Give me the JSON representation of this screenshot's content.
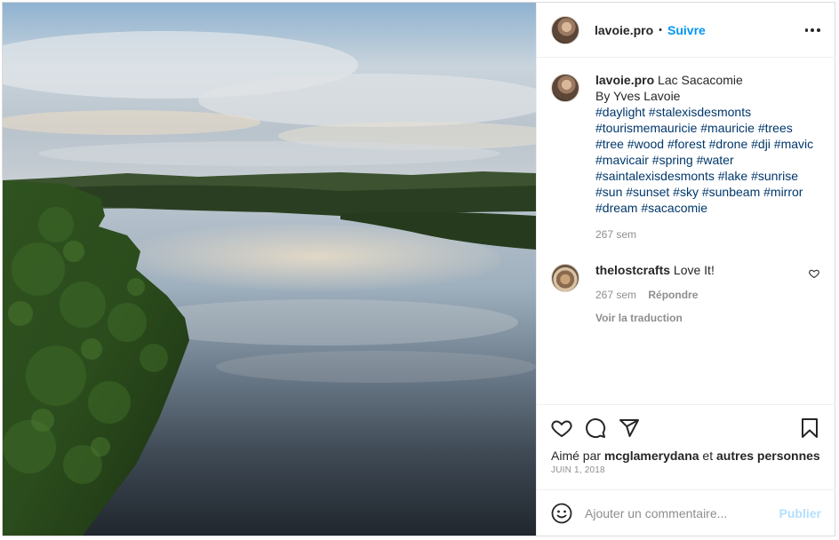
{
  "header": {
    "username": "lavoie.pro",
    "separator": "•",
    "follow_label": "Suivre"
  },
  "caption": {
    "username": "lavoie.pro",
    "title": "Lac Sacacomie",
    "byline": "By Yves Lavoie",
    "hashtags": "#daylight #stalexisdesmonts #tourismemauricie #mauricie #trees #tree #wood #forest #drone #dji #mavic #mavicair #spring #water #saintalexisdesmonts #lake #sunrise #sun #sunset #sky #sunbeam #mirror #dream #sacacomie",
    "age": "267 sem"
  },
  "comment": {
    "username": "thelostcrafts",
    "text": "Love It!",
    "age": "267 sem",
    "reply_label": "Répondre",
    "translate_label": "Voir la traduction"
  },
  "likes": {
    "prefix": "Aimé par",
    "user": "mcglamerydana",
    "conj": "et",
    "others": "autres personnes"
  },
  "post_date": "JUIN 1, 2018",
  "add_comment": {
    "placeholder": "Ajouter un commentaire...",
    "publish_label": "Publier"
  },
  "icons": {
    "more": "more-horizontal-icon",
    "like": "heart-icon",
    "comment": "comment-bubble-icon",
    "share": "paper-plane-icon",
    "save": "bookmark-icon",
    "emoji": "emoji-smiley-icon",
    "comment_like": "small-heart-icon"
  },
  "colors": {
    "link_blue": "#0095f6",
    "hashtag": "#00376b",
    "muted": "#8e8e8e",
    "publish_disabled": "#b2dffc"
  }
}
